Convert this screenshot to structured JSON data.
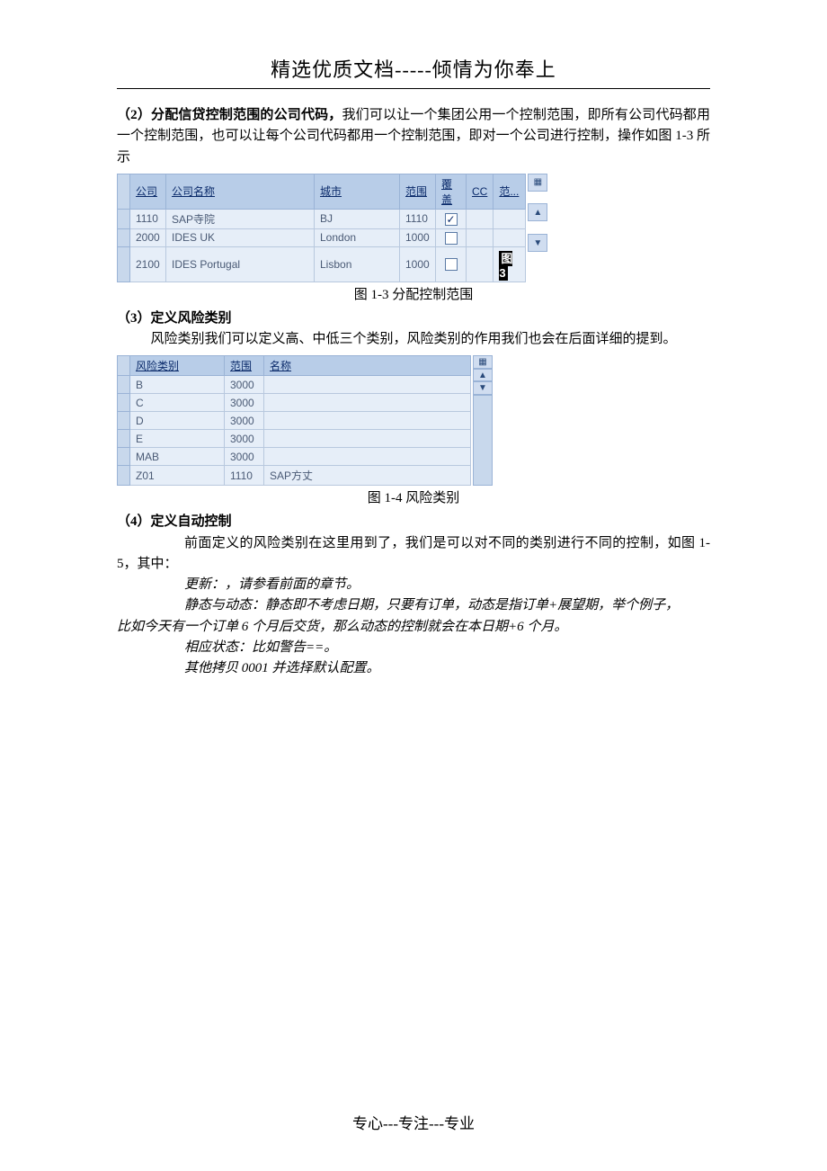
{
  "header": {
    "title": "精选优质文档-----倾情为你奉上"
  },
  "section2": {
    "head_prefix": "（2）",
    "head_bold": "分配信贷控制范围的公司代码，",
    "head_rest": "我们可以让一个集团公用一个控制范围，即所有公司代码都用一个控制范围，也可以让每个公司代码都用一个控制范围，即对一个公司进行控制，操作如图 1-3 所示"
  },
  "table1": {
    "headers": [
      "公司",
      "公司名称",
      "城市",
      "范围",
      "覆盖",
      "CC",
      "范..."
    ],
    "rows": [
      {
        "code": "1110",
        "name": "SAP寺院",
        "city": "BJ",
        "range": "1110",
        "cover_checked": true
      },
      {
        "code": "2000",
        "name": "IDES UK",
        "city": "London",
        "range": "1000",
        "cover_checked": false
      },
      {
        "code": "2100",
        "name": "IDES Portugal",
        "city": "Lisbon",
        "range": "1000",
        "cover_checked": false
      }
    ],
    "badge": "图 3",
    "caption": "图 1-3 分配控制范围"
  },
  "section3": {
    "head": "（3）定义风险类别",
    "para": "风险类别我们可以定义高、中低三个类别，风险类别的作用我们也会在后面详细的提到。"
  },
  "table2": {
    "headers": [
      "风险类别",
      "范围",
      "名称"
    ],
    "rows": [
      {
        "risk": "B",
        "range": "3000",
        "name": ""
      },
      {
        "risk": "C",
        "range": "3000",
        "name": ""
      },
      {
        "risk": "D",
        "range": "3000",
        "name": ""
      },
      {
        "risk": "E",
        "range": "3000",
        "name": ""
      },
      {
        "risk": "MAB",
        "range": "3000",
        "name": ""
      },
      {
        "risk": "Z01",
        "range": "1110",
        "name": "SAP方丈"
      }
    ],
    "caption": "图 1-4  风险类别"
  },
  "section4": {
    "head": "（4）定义自动控制",
    "p1": "前面定义的风险类别在这里用到了，我们是可以对不同的类别进行不同的控制，如图 1-5，其中：",
    "p2": "更新：，请参看前面的章节。",
    "p3_a": "静态与动态：静态即不考虑日期，只要有订单，动态是指订单+展望期，举个例子，",
    "p3_b": "比如今天有一个订单 6 个月后交货，那么动态的控制就会在本日期+6 个月。",
    "p4": "相应状态：比如警告==。",
    "p5": "其他拷贝 0001 并选择默认配置。"
  },
  "footer": {
    "text": "专心---专注---专业"
  }
}
